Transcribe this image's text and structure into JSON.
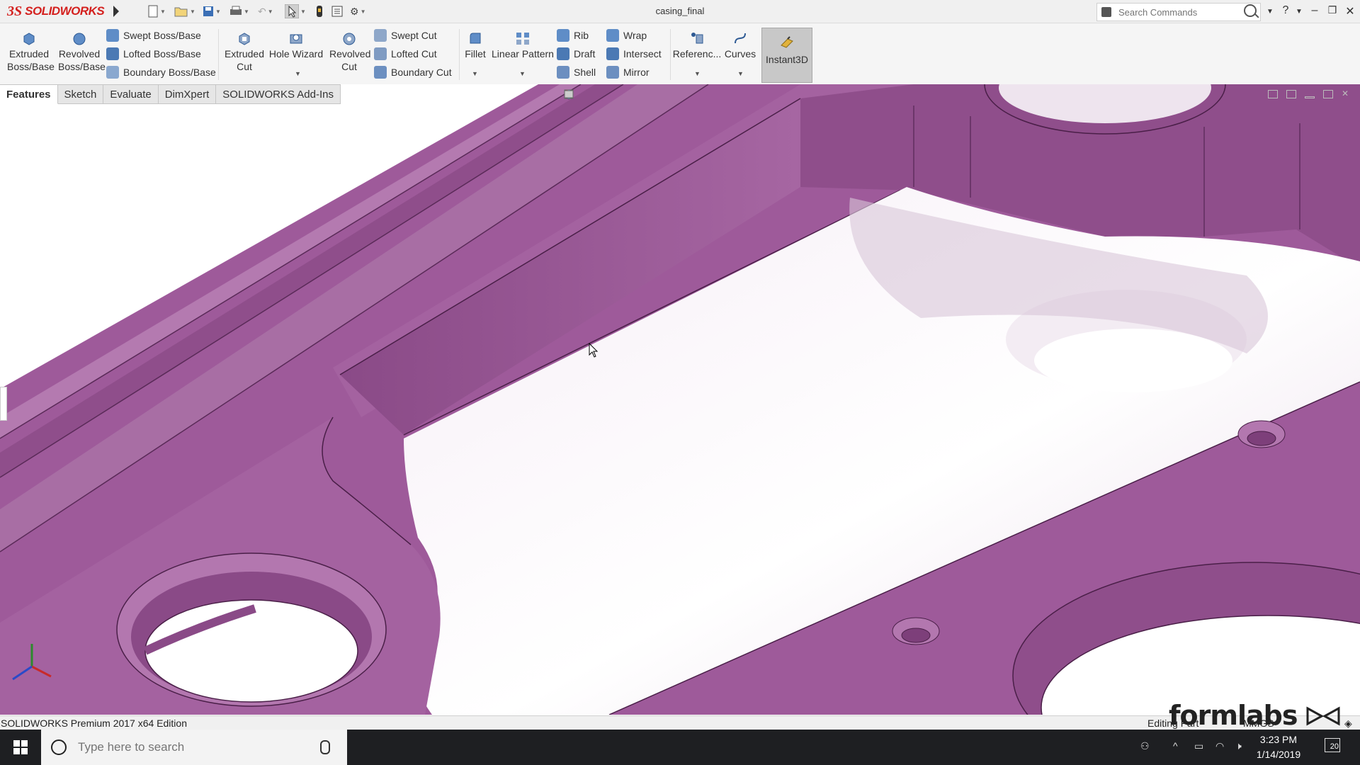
{
  "app": {
    "brand": "SOLIDWORKS",
    "document_title": "casing_final"
  },
  "search": {
    "placeholder": "Search Commands"
  },
  "toolbar": {
    "big_buttons": {
      "extruded_boss": "Extruded Boss/Base",
      "revolved_boss": "Revolved Boss/Base",
      "extruded_cut": "Extruded Cut",
      "hole_wizard": "Hole Wizard",
      "revolved_cut": "Revolved Cut",
      "fillet": "Fillet",
      "linear_pattern": "Linear Pattern",
      "reference": "Referenc...",
      "curves": "Curves",
      "instant3d": "Instant3D"
    },
    "small_buttons": {
      "swept_boss": "Swept Boss/Base",
      "lofted_boss": "Lofted Boss/Base",
      "boundary_boss": "Boundary Boss/Base",
      "swept_cut": "Swept Cut",
      "lofted_cut": "Lofted Cut",
      "boundary_cut": "Boundary Cut",
      "rib": "Rib",
      "draft": "Draft",
      "shell": "Shell",
      "wrap": "Wrap",
      "intersect": "Intersect",
      "mirror": "Mirror"
    }
  },
  "tabs": [
    "Features",
    "Sketch",
    "Evaluate",
    "DimXpert",
    "SOLIDWORKS Add-Ins"
  ],
  "status": {
    "edition": "SOLIDWORKS Premium 2017 x64 Edition",
    "mode": "Editing Part",
    "units": "MMGS"
  },
  "watermark": "formlabs",
  "taskbar": {
    "search_placeholder": "Type here to search",
    "time": "3:23 PM",
    "date": "1/14/2019",
    "notification_count": "20"
  },
  "colors": {
    "model_purple": "#9e5a9a",
    "brand_red": "#d4201e"
  }
}
